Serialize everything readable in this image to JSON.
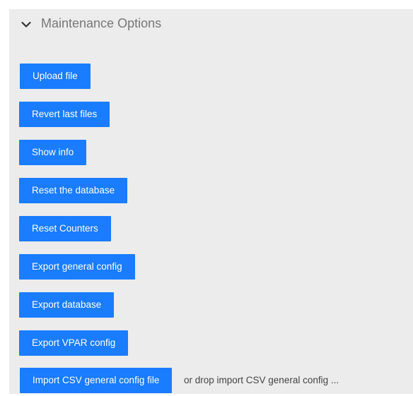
{
  "panel": {
    "title": "Maintenance Options",
    "chevron_icon": "chevron-down-icon"
  },
  "buttons": {
    "upload_file": "Upload file",
    "revert_last_files": "Revert last files",
    "show_info": "Show info",
    "reset_database": "Reset the database",
    "reset_counters": "Reset Counters",
    "export_general_config": "Export general config",
    "export_database": "Export database",
    "export_vpar_config": "Export VPAR config",
    "import_csv_general_config": "Import CSV general config file"
  },
  "drop_zone": {
    "text": "or drop import CSV general config ..."
  },
  "colors": {
    "button_bg": "#1a7cff",
    "panel_bg": "#ececec",
    "title_color": "#777777"
  }
}
